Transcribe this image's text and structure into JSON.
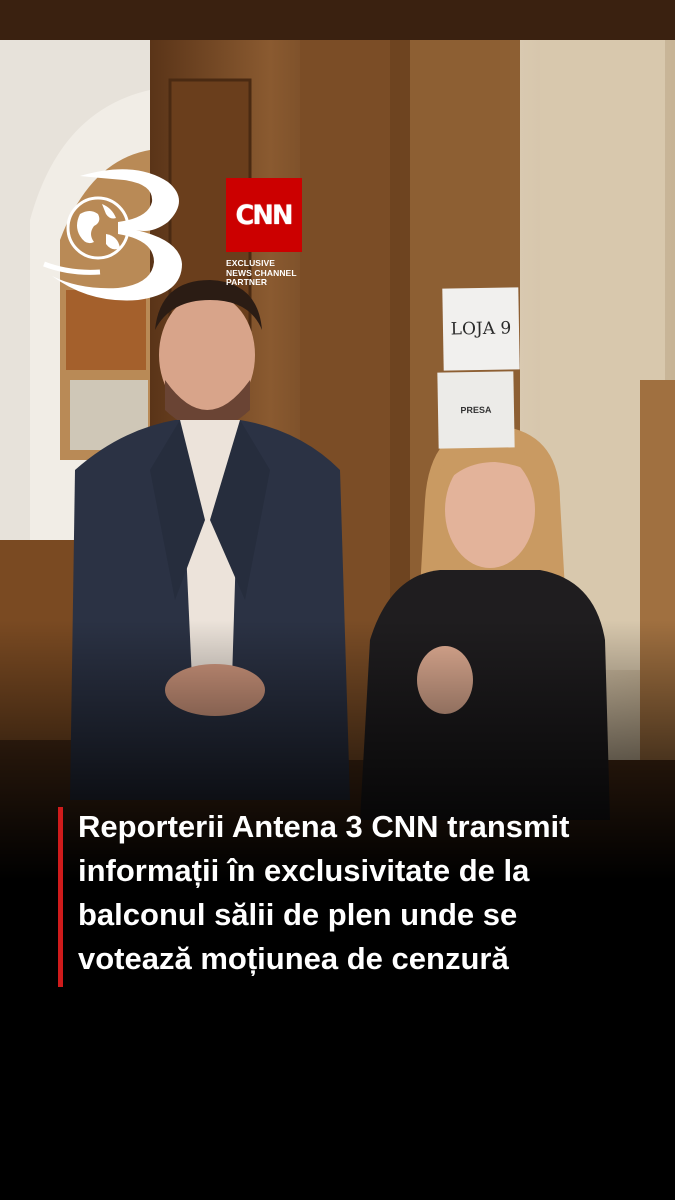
{
  "channel": {
    "logo": "antena-3-globe-logo",
    "partner_brand": "CNN",
    "partner_line1": "EXCLUSIVE",
    "partner_line2": "NEWS CHANNEL",
    "partner_line3": "PARTNER"
  },
  "scene": {
    "sign_room": "LOJA 9",
    "sign_press": "PRESA"
  },
  "caption": {
    "line1": "Reporterii Antena 3 CNN transmit",
    "line2": "informații în exclusivitate de la",
    "line3": "balconul sălii de plen unde se",
    "line4": "votează moțiunea de cenzură"
  },
  "colors": {
    "accent_red": "#cf1b1b",
    "cnn_red": "#cc0000",
    "background": "#000000"
  }
}
